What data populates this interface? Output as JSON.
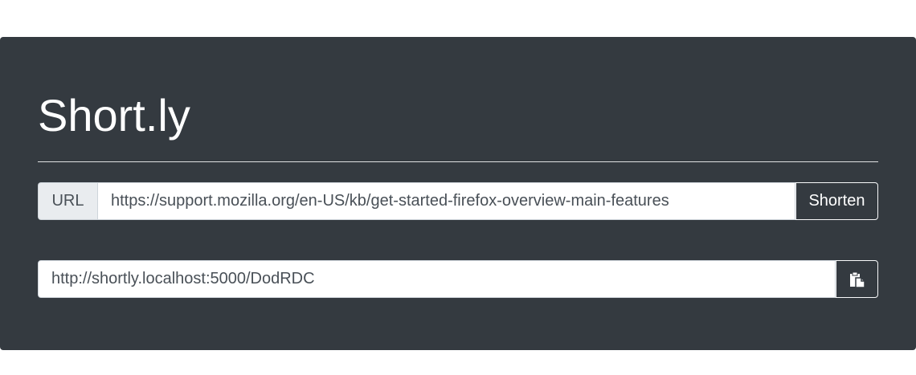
{
  "app": {
    "title": "Short.ly"
  },
  "url_form": {
    "prefix_label": "URL",
    "url_value": "https://support.mozilla.org/en-US/kb/get-started-firefox-overview-main-features",
    "submit_label": "Shorten"
  },
  "result": {
    "short_url": "http://shortly.localhost:5000/DodRDC",
    "copy_icon": "clipboard-icon"
  },
  "colors": {
    "background": "#343a40",
    "text": "#ffffff",
    "input_addon": "#e9ecef"
  }
}
